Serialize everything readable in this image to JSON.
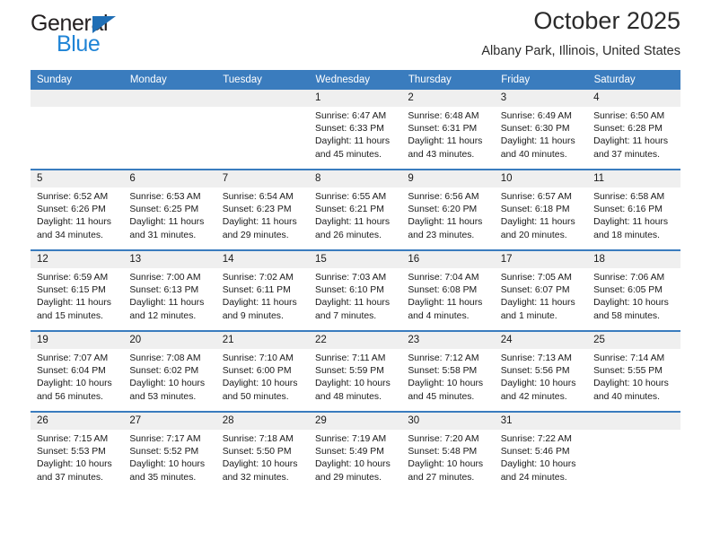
{
  "brand": {
    "name_top": "General",
    "name_bottom": "Blue",
    "accent_color": "#1f84d6",
    "triangle_color": "#1f6eb5"
  },
  "header": {
    "title": "October 2025",
    "subtitle": "Albany Park, Illinois, United States",
    "header_bg": "#3a7cbe",
    "header_text_color": "#ffffff"
  },
  "weekdays": [
    "Sunday",
    "Monday",
    "Tuesday",
    "Wednesday",
    "Thursday",
    "Friday",
    "Saturday"
  ],
  "labels": {
    "sunrise_prefix": "Sunrise:",
    "sunset_prefix": "Sunset:",
    "daylight_prefix": "Daylight:"
  },
  "weeks": [
    [
      {
        "day": "",
        "sunrise": "",
        "sunset": "",
        "daylight_line1": "",
        "daylight_line2": ""
      },
      {
        "day": "",
        "sunrise": "",
        "sunset": "",
        "daylight_line1": "",
        "daylight_line2": ""
      },
      {
        "day": "",
        "sunrise": "",
        "sunset": "",
        "daylight_line1": "",
        "daylight_line2": ""
      },
      {
        "day": "1",
        "sunrise": "Sunrise: 6:47 AM",
        "sunset": "Sunset: 6:33 PM",
        "daylight_line1": "Daylight: 11 hours",
        "daylight_line2": "and 45 minutes."
      },
      {
        "day": "2",
        "sunrise": "Sunrise: 6:48 AM",
        "sunset": "Sunset: 6:31 PM",
        "daylight_line1": "Daylight: 11 hours",
        "daylight_line2": "and 43 minutes."
      },
      {
        "day": "3",
        "sunrise": "Sunrise: 6:49 AM",
        "sunset": "Sunset: 6:30 PM",
        "daylight_line1": "Daylight: 11 hours",
        "daylight_line2": "and 40 minutes."
      },
      {
        "day": "4",
        "sunrise": "Sunrise: 6:50 AM",
        "sunset": "Sunset: 6:28 PM",
        "daylight_line1": "Daylight: 11 hours",
        "daylight_line2": "and 37 minutes."
      }
    ],
    [
      {
        "day": "5",
        "sunrise": "Sunrise: 6:52 AM",
        "sunset": "Sunset: 6:26 PM",
        "daylight_line1": "Daylight: 11 hours",
        "daylight_line2": "and 34 minutes."
      },
      {
        "day": "6",
        "sunrise": "Sunrise: 6:53 AM",
        "sunset": "Sunset: 6:25 PM",
        "daylight_line1": "Daylight: 11 hours",
        "daylight_line2": "and 31 minutes."
      },
      {
        "day": "7",
        "sunrise": "Sunrise: 6:54 AM",
        "sunset": "Sunset: 6:23 PM",
        "daylight_line1": "Daylight: 11 hours",
        "daylight_line2": "and 29 minutes."
      },
      {
        "day": "8",
        "sunrise": "Sunrise: 6:55 AM",
        "sunset": "Sunset: 6:21 PM",
        "daylight_line1": "Daylight: 11 hours",
        "daylight_line2": "and 26 minutes."
      },
      {
        "day": "9",
        "sunrise": "Sunrise: 6:56 AM",
        "sunset": "Sunset: 6:20 PM",
        "daylight_line1": "Daylight: 11 hours",
        "daylight_line2": "and 23 minutes."
      },
      {
        "day": "10",
        "sunrise": "Sunrise: 6:57 AM",
        "sunset": "Sunset: 6:18 PM",
        "daylight_line1": "Daylight: 11 hours",
        "daylight_line2": "and 20 minutes."
      },
      {
        "day": "11",
        "sunrise": "Sunrise: 6:58 AM",
        "sunset": "Sunset: 6:16 PM",
        "daylight_line1": "Daylight: 11 hours",
        "daylight_line2": "and 18 minutes."
      }
    ],
    [
      {
        "day": "12",
        "sunrise": "Sunrise: 6:59 AM",
        "sunset": "Sunset: 6:15 PM",
        "daylight_line1": "Daylight: 11 hours",
        "daylight_line2": "and 15 minutes."
      },
      {
        "day": "13",
        "sunrise": "Sunrise: 7:00 AM",
        "sunset": "Sunset: 6:13 PM",
        "daylight_line1": "Daylight: 11 hours",
        "daylight_line2": "and 12 minutes."
      },
      {
        "day": "14",
        "sunrise": "Sunrise: 7:02 AM",
        "sunset": "Sunset: 6:11 PM",
        "daylight_line1": "Daylight: 11 hours",
        "daylight_line2": "and 9 minutes."
      },
      {
        "day": "15",
        "sunrise": "Sunrise: 7:03 AM",
        "sunset": "Sunset: 6:10 PM",
        "daylight_line1": "Daylight: 11 hours",
        "daylight_line2": "and 7 minutes."
      },
      {
        "day": "16",
        "sunrise": "Sunrise: 7:04 AM",
        "sunset": "Sunset: 6:08 PM",
        "daylight_line1": "Daylight: 11 hours",
        "daylight_line2": "and 4 minutes."
      },
      {
        "day": "17",
        "sunrise": "Sunrise: 7:05 AM",
        "sunset": "Sunset: 6:07 PM",
        "daylight_line1": "Daylight: 11 hours",
        "daylight_line2": "and 1 minute."
      },
      {
        "day": "18",
        "sunrise": "Sunrise: 7:06 AM",
        "sunset": "Sunset: 6:05 PM",
        "daylight_line1": "Daylight: 10 hours",
        "daylight_line2": "and 58 minutes."
      }
    ],
    [
      {
        "day": "19",
        "sunrise": "Sunrise: 7:07 AM",
        "sunset": "Sunset: 6:04 PM",
        "daylight_line1": "Daylight: 10 hours",
        "daylight_line2": "and 56 minutes."
      },
      {
        "day": "20",
        "sunrise": "Sunrise: 7:08 AM",
        "sunset": "Sunset: 6:02 PM",
        "daylight_line1": "Daylight: 10 hours",
        "daylight_line2": "and 53 minutes."
      },
      {
        "day": "21",
        "sunrise": "Sunrise: 7:10 AM",
        "sunset": "Sunset: 6:00 PM",
        "daylight_line1": "Daylight: 10 hours",
        "daylight_line2": "and 50 minutes."
      },
      {
        "day": "22",
        "sunrise": "Sunrise: 7:11 AM",
        "sunset": "Sunset: 5:59 PM",
        "daylight_line1": "Daylight: 10 hours",
        "daylight_line2": "and 48 minutes."
      },
      {
        "day": "23",
        "sunrise": "Sunrise: 7:12 AM",
        "sunset": "Sunset: 5:58 PM",
        "daylight_line1": "Daylight: 10 hours",
        "daylight_line2": "and 45 minutes."
      },
      {
        "day": "24",
        "sunrise": "Sunrise: 7:13 AM",
        "sunset": "Sunset: 5:56 PM",
        "daylight_line1": "Daylight: 10 hours",
        "daylight_line2": "and 42 minutes."
      },
      {
        "day": "25",
        "sunrise": "Sunrise: 7:14 AM",
        "sunset": "Sunset: 5:55 PM",
        "daylight_line1": "Daylight: 10 hours",
        "daylight_line2": "and 40 minutes."
      }
    ],
    [
      {
        "day": "26",
        "sunrise": "Sunrise: 7:15 AM",
        "sunset": "Sunset: 5:53 PM",
        "daylight_line1": "Daylight: 10 hours",
        "daylight_line2": "and 37 minutes."
      },
      {
        "day": "27",
        "sunrise": "Sunrise: 7:17 AM",
        "sunset": "Sunset: 5:52 PM",
        "daylight_line1": "Daylight: 10 hours",
        "daylight_line2": "and 35 minutes."
      },
      {
        "day": "28",
        "sunrise": "Sunrise: 7:18 AM",
        "sunset": "Sunset: 5:50 PM",
        "daylight_line1": "Daylight: 10 hours",
        "daylight_line2": "and 32 minutes."
      },
      {
        "day": "29",
        "sunrise": "Sunrise: 7:19 AM",
        "sunset": "Sunset: 5:49 PM",
        "daylight_line1": "Daylight: 10 hours",
        "daylight_line2": "and 29 minutes."
      },
      {
        "day": "30",
        "sunrise": "Sunrise: 7:20 AM",
        "sunset": "Sunset: 5:48 PM",
        "daylight_line1": "Daylight: 10 hours",
        "daylight_line2": "and 27 minutes."
      },
      {
        "day": "31",
        "sunrise": "Sunrise: 7:22 AM",
        "sunset": "Sunset: 5:46 PM",
        "daylight_line1": "Daylight: 10 hours",
        "daylight_line2": "and 24 minutes."
      },
      {
        "day": "",
        "sunrise": "",
        "sunset": "",
        "daylight_line1": "",
        "daylight_line2": ""
      }
    ]
  ]
}
